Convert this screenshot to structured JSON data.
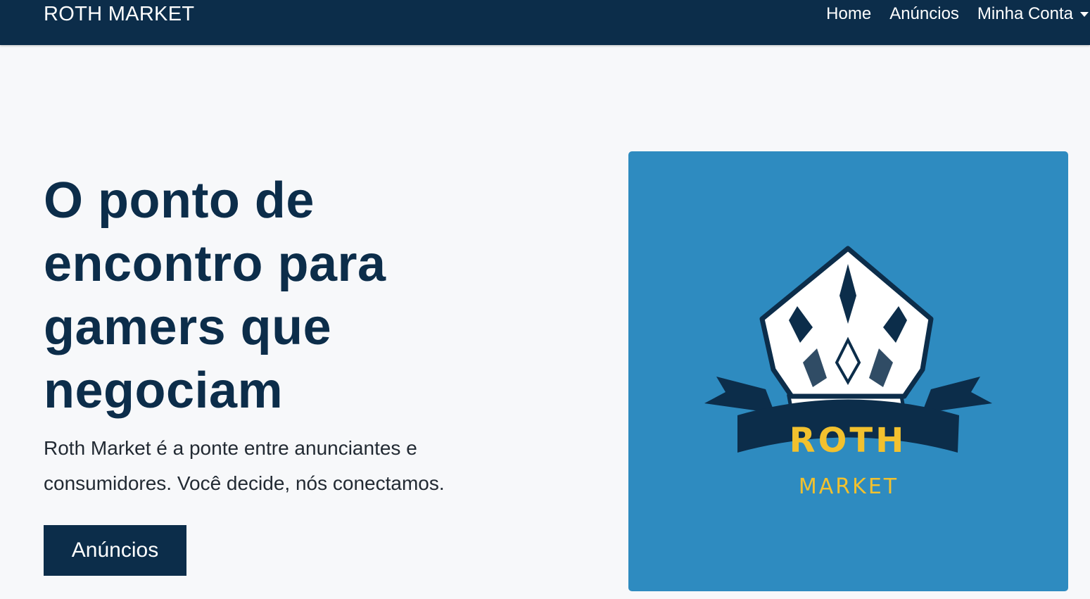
{
  "nav": {
    "brand": "ROTH MARKET",
    "links": {
      "home": "Home",
      "anuncios": "Anúncios",
      "account": "Minha Conta"
    }
  },
  "hero": {
    "title": "O ponto de encontro para gamers que negociam",
    "text": "Roth Market é a ponte entre anunciantes e consumidores. Você decide, nós conectamos.",
    "button_label": "Anúncios"
  },
  "logo": {
    "word1": "ROTH",
    "word2": "MARKET",
    "icon": "crown-icon"
  },
  "colors": {
    "navbar": "#0c2d4a",
    "page_bg": "#f7f8fa",
    "title": "#0c2d4a",
    "logo_bg": "#2e8bc0",
    "logo_gold": "#f2c12e"
  }
}
